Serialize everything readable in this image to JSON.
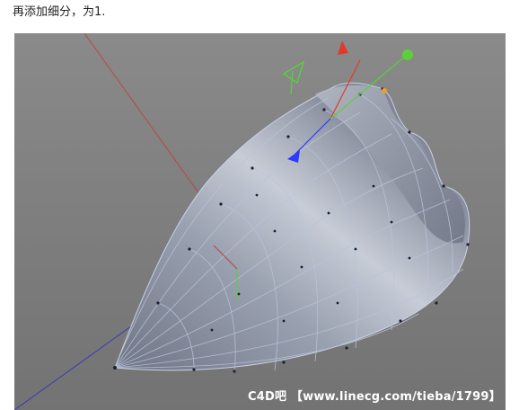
{
  "caption": "再添加细分，为1.",
  "viewport": {
    "background": "#808080",
    "mesh_fill": "#8f96a6",
    "mesh_line": "#b8c4dc",
    "mesh_points": "#1a2033",
    "axis_x_color": "#e23a2a",
    "axis_y_color": "#5ad13a",
    "axis_z_color": "#2a3aff",
    "handle_color": "#f0a020",
    "icons": [
      "move-axis-x-icon",
      "move-axis-y-icon",
      "move-axis-z-icon",
      "rotate-handle-icon"
    ]
  },
  "watermark": {
    "site": "C4D吧",
    "url": "【www.linecg.com/tieba/1799】"
  }
}
